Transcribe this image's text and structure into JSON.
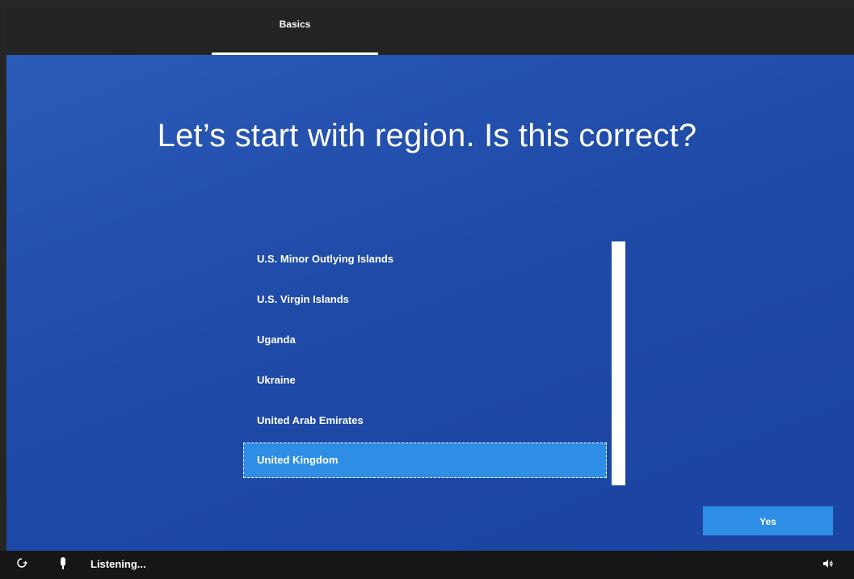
{
  "tabs": {
    "active_label": "Basics"
  },
  "main": {
    "heading": "Let’s start with region. Is this correct?"
  },
  "region_list": {
    "items": [
      {
        "label": "U.S. Minor Outlying Islands",
        "selected": false
      },
      {
        "label": "U.S. Virgin Islands",
        "selected": false
      },
      {
        "label": "Uganda",
        "selected": false
      },
      {
        "label": "Ukraine",
        "selected": false
      },
      {
        "label": "United Arab Emirates",
        "selected": false
      },
      {
        "label": "United Kingdom",
        "selected": true
      }
    ]
  },
  "actions": {
    "yes_label": "Yes"
  },
  "bottom_bar": {
    "status_text": "Listening...",
    "icons": [
      "ease-of-access-icon",
      "microphone-icon",
      "volume-icon"
    ]
  },
  "colors": {
    "background_blue": "#1f4aa8",
    "accent_blue": "#2e8ee6",
    "text": "#ffffff"
  }
}
